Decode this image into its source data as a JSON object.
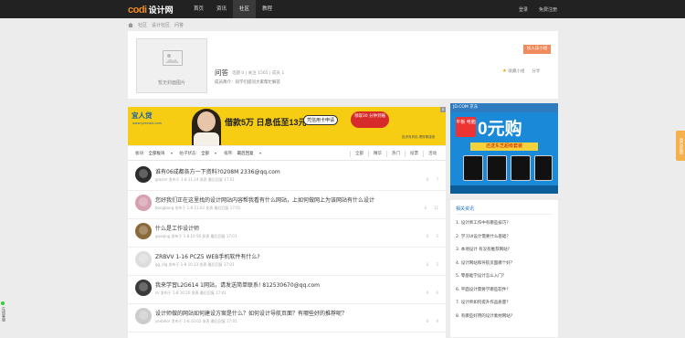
{
  "topbar": {
    "logo_c": "codi",
    "logo_t": "设计网",
    "nav": [
      "首页",
      "资讯",
      "社区",
      "教程"
    ],
    "active_nav": 2,
    "links": [
      "登录",
      "免费注册"
    ]
  },
  "crumb": [
    "社区",
    "设计社区",
    "问答"
  ],
  "group": {
    "cover_label": "暂无封面图片",
    "name": "问答",
    "stats": "话题 0 | 关注 1565 | 成员 1",
    "desc": "成员简介：同学们提问大家帮忙解答",
    "join": "加入该小组",
    "fav": "收藏小组",
    "share": "分享"
  },
  "banner": {
    "brand": "宜人贷",
    "brand_sub": "www.yirendai.com",
    "headline": "借款5万 日息低至13元",
    "apply": "凭信用卡申请",
    "promo": "领取30 分钟到账",
    "note": "投资有风险 理财需谨慎",
    "tag": "广告"
  },
  "jd": {
    "header": "JD.COM 京东",
    "big": "0元购",
    "side": "平板 电脑",
    "bar": "还送东芝超级套装"
  },
  "filters": {
    "f1_label": "板块:",
    "f1_value": "全部板块",
    "f2_label": "帖子状态:",
    "f2_value": "全部",
    "f3_label": "排序:",
    "f3_value": "最后回复",
    "tabs": [
      "全部",
      "精华",
      "热门",
      "投票",
      "活动"
    ]
  },
  "posts": [
    {
      "title": "谁有06成都各方一下资料?0208M 2336@qq.com",
      "meta": "glacier 发布于 1-8 11:24 发表 最后回复 17:01",
      "replies": "0",
      "views": "7"
    },
    {
      "title": "您好我们正在这里找的设计网站内容帮我看有什么网站，上如何做网上为该网站有什么设计",
      "meta": "bongbong 发布于 1-8 11:02 发表 最后回复 17:01",
      "replies": "4",
      "views": "11"
    },
    {
      "title": "什么是工作设计师",
      "meta": "gaoqing 发布于 1-8 10:56 发表 最后回复 17:01",
      "replies": "0",
      "views": "5"
    },
    {
      "title": "ZRBVV 1-16 PCZ5 WEB手机软件有什么?",
      "meta": "gg_dig 发布于 1-8 10:33 发表 最后回复 17:01",
      "replies": "0",
      "views": "5"
    },
    {
      "title": "我来学習L2G614 1网站，请发送简单联系! 812530670@qq.com",
      "meta": "ck 发布于 1-8 10:20 发表 最后回复 17:01",
      "replies": "0",
      "views": "6"
    },
    {
      "title": "设计师做的网站如何建设方案是什么？如何设计导航页面？有哪些好的推荐呢？",
      "meta": "yedahor 发布于 1-8 10:02 发表 最后回复 17:01",
      "replies": "0",
      "views": "9"
    }
  ],
  "side": {
    "title": "相关资讯",
    "items": [
      "1. 设计师工作中有哪些技巧？",
      "2. 学习UI设计需要什么基础？",
      "3. 本地设计 有没有推荐网站？",
      "4. 设计网站和导航页面哪个好？",
      "5. 零基础学设计怎么入门？",
      "6. 平面设计需要学哪些软件？",
      "7. 设计师如何提升作品质量？",
      "8. 有哪些好用的设计素材网站？"
    ]
  },
  "feedback": "意见反馈",
  "online": "在线客服"
}
